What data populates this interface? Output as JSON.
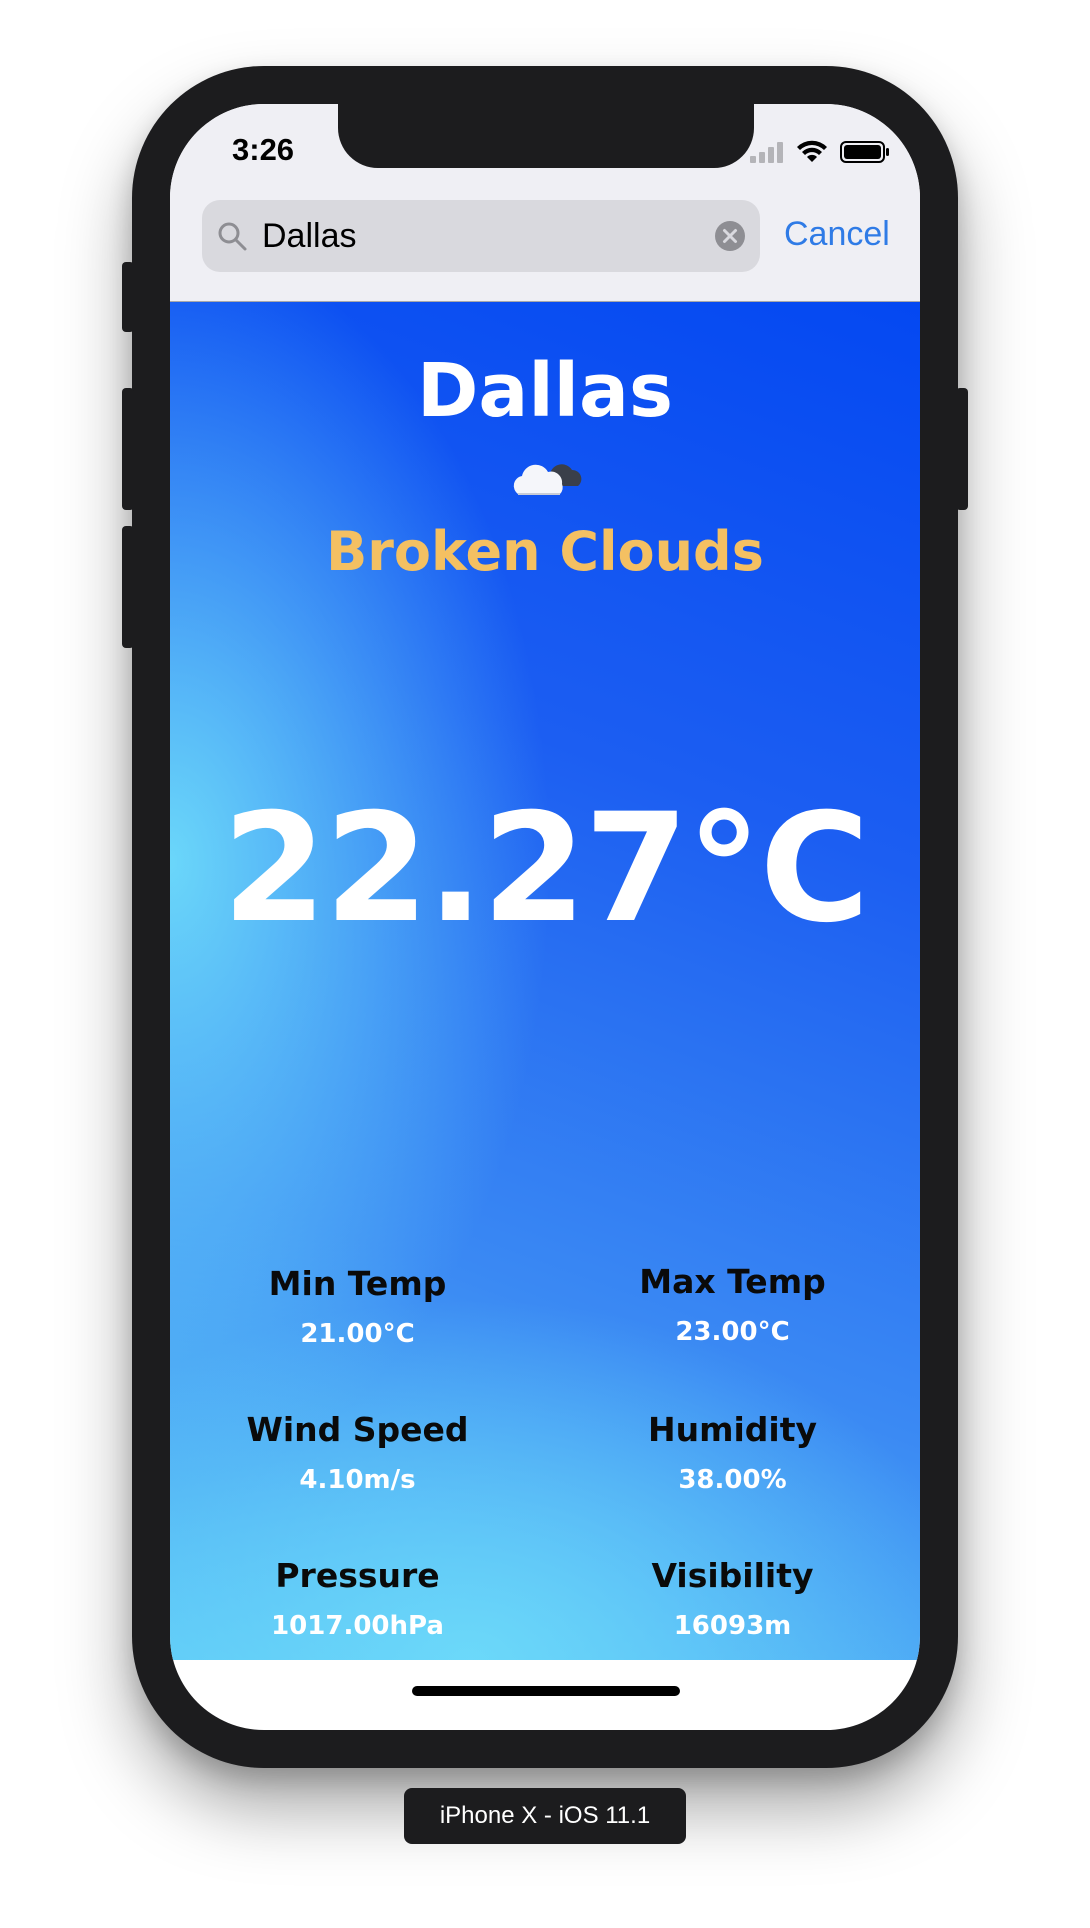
{
  "status_bar": {
    "time": "3:26",
    "icons": [
      "cellular-signal-icon",
      "wifi-icon",
      "battery-icon"
    ]
  },
  "search": {
    "value": "Dallas",
    "cancel_label": "Cancel",
    "icons": [
      "search-icon",
      "clear-icon"
    ]
  },
  "weather": {
    "city": "Dallas",
    "condition_icon": "broken-clouds-icon",
    "description": "Broken Clouds",
    "temperature": "22.27°C",
    "stats": [
      {
        "label": "Min Temp",
        "value": "21.00°C"
      },
      {
        "label": "Max Temp",
        "value": "23.00°C"
      },
      {
        "label": "Wind Speed",
        "value": "4.10m/s"
      },
      {
        "label": "Humidity",
        "value": "38.00%"
      },
      {
        "label": "Pressure",
        "value": "1017.00hPa"
      },
      {
        "label": "Visibility",
        "value": "16093m"
      }
    ]
  },
  "device_caption": "iPhone X - iOS 11.1",
  "colors": {
    "accent": "#2f7be6",
    "description": "#f4c062",
    "gradient_top": "#0448f2",
    "gradient_bottom": "#5cc6f6"
  }
}
